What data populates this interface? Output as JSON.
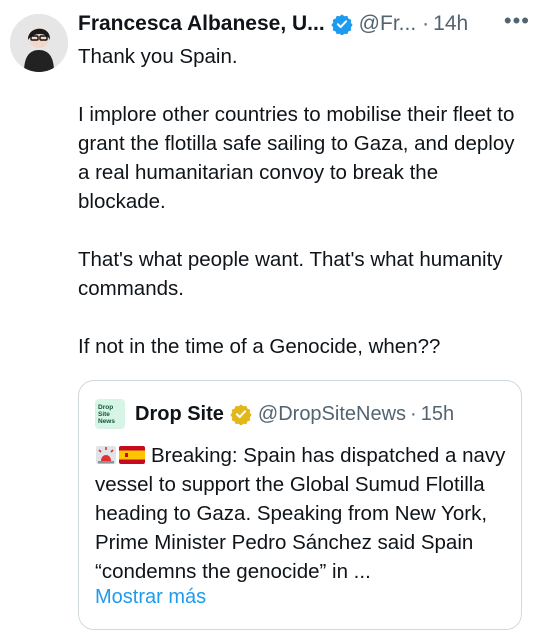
{
  "tweet": {
    "author_name": "Francesca Albanese, U...",
    "handle": "@Fr...",
    "separator": "·",
    "time": "14h",
    "more_label": "•••",
    "paragraphs": [
      "Thank you Spain.",
      "I implore other countries to mobilise their fleet to grant the flotilla safe sailing to Gaza, and deploy a real humanitarian convoy to break the blockade.",
      "That's what people want. That's what humanity commands.",
      "If not in the time of a Genocide, when??"
    ]
  },
  "quote": {
    "logo_text": [
      "Drop",
      "Site",
      "News"
    ],
    "author_name": "Drop Site",
    "handle": "@DropSiteNews",
    "separator": "·",
    "time": "15h",
    "text": "Breaking: Spain has dispatched a navy vessel to support the Global Sumud Flotilla heading to Gaza. Speaking from New York, Prime Minister Pedro Sánchez said Spain “condemns the genocide” in ...",
    "show_more": "Mostrar más"
  },
  "colors": {
    "text": "#0f1419",
    "secondary": "#536471",
    "link": "#1d9bf0",
    "verified_blue": "#1d9bf0",
    "verified_gold": "#e2b719"
  },
  "icons": [
    "avatar",
    "verified-badge-icon",
    "more-icon",
    "drop-site-logo",
    "gold-verified-badge-icon",
    "siren-emoji",
    "spain-flag-emoji"
  ]
}
